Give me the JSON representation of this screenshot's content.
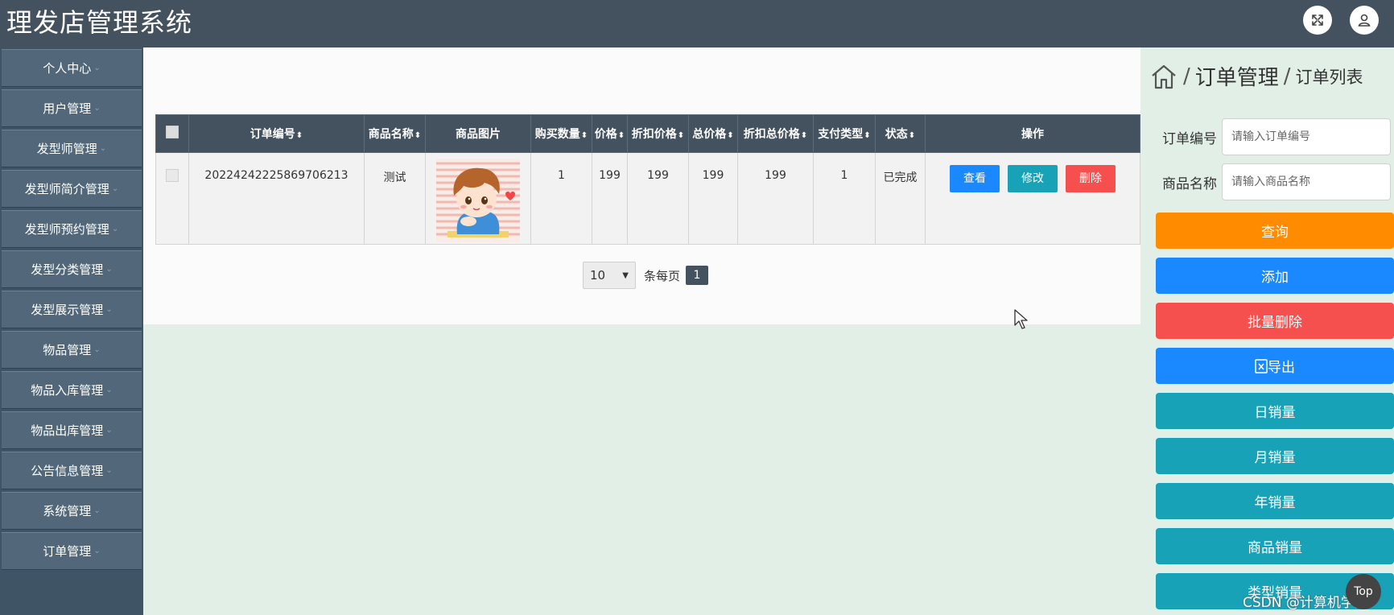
{
  "app": {
    "title": "理发店管理系统"
  },
  "header": {
    "icons": [
      "fullscreen-icon",
      "user-icon"
    ]
  },
  "sidebar": {
    "items": [
      {
        "label": "个人中心"
      },
      {
        "label": "用户管理"
      },
      {
        "label": "发型师管理"
      },
      {
        "label": "发型师简介管理"
      },
      {
        "label": "发型师预约管理"
      },
      {
        "label": "发型分类管理"
      },
      {
        "label": "发型展示管理"
      },
      {
        "label": "物品管理"
      },
      {
        "label": "物品入库管理"
      },
      {
        "label": "物品出库管理"
      },
      {
        "label": "公告信息管理"
      },
      {
        "label": "系统管理"
      },
      {
        "label": "订单管理"
      }
    ]
  },
  "breadcrumb": {
    "section": "订单管理",
    "page": "订单列表",
    "separator": "/"
  },
  "table": {
    "columns": [
      "订单编号",
      "商品名称",
      "商品图片",
      "购买数量",
      "价格",
      "折扣价格",
      "总价格",
      "折扣总价格",
      "支付类型",
      "状态",
      "操作"
    ],
    "rows": [
      {
        "order_no": "20224242225869706213",
        "product_name": "测试",
        "image": "cartoon-boy-image",
        "quantity": "1",
        "price": "199",
        "discount_price": "199",
        "total_price": "199",
        "discount_total": "199",
        "pay_type": "1",
        "status": "已完成",
        "actions": {
          "view": "查看",
          "edit": "修改",
          "delete": "删除"
        }
      }
    ]
  },
  "pagination": {
    "page_size": "10",
    "per_page_label": "条每页",
    "current_page": "1"
  },
  "search": {
    "order_no_label": "订单编号",
    "order_no_placeholder": "请输入订单编号",
    "product_name_label": "商品名称",
    "product_name_placeholder": "请输入商品名称"
  },
  "buttons": {
    "query": "查询",
    "add": "添加",
    "batch_delete": "批量删除",
    "export": "导出",
    "daily_sales": "日销量",
    "monthly_sales": "月销量",
    "yearly_sales": "年销量",
    "product_sales": "商品销量",
    "type_sales": "类型销量"
  },
  "colors": {
    "header": "#44515e",
    "query": "#ff8c00",
    "primary": "#1a89ff",
    "danger": "#f5504e",
    "teal": "#18a2b8"
  },
  "watermark": "CSDN @计算机学姐",
  "back_to_top": "Top"
}
